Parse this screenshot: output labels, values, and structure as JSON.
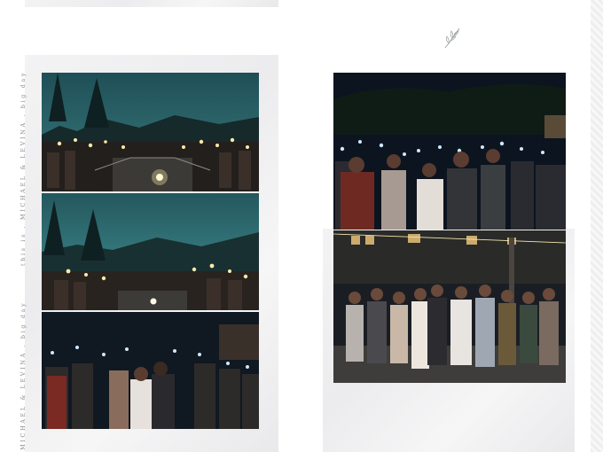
{
  "spread": {
    "side_text": [
      "this is . MICHAEL & LEVINA . big day",
      "MICHAEL & LEVINA . big day"
    ],
    "ornament": "leaf-sprig-icon"
  },
  "photos": [
    {
      "name": "sparkler-exit-bridge"
    },
    {
      "name": "sparkler-exit-hillside"
    },
    {
      "name": "phone-light-kiss"
    },
    {
      "name": "phone-light-crowd"
    },
    {
      "name": "group-portrait-house"
    }
  ]
}
